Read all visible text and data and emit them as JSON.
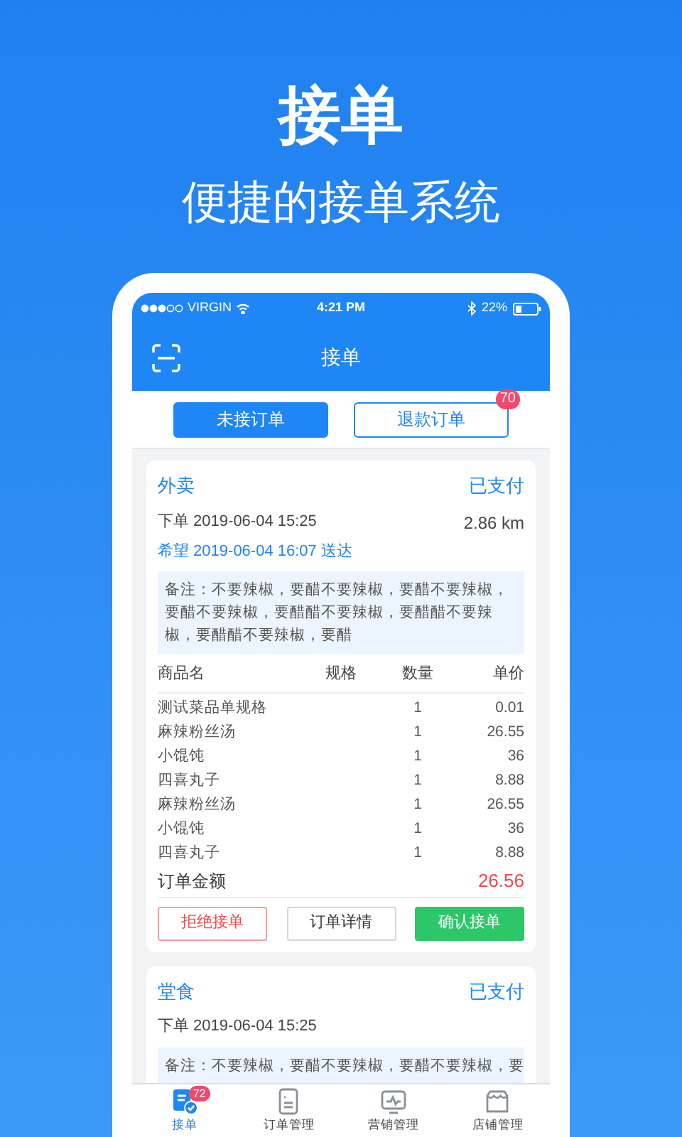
{
  "headline": "接单",
  "subheadline": "便捷的接单系统",
  "status_bar": {
    "carrier": "VIRGIN",
    "time": "4:21 PM",
    "battery": "22%"
  },
  "nav": {
    "title": "接单"
  },
  "tabs": [
    {
      "label": "未接订单",
      "selected": true
    },
    {
      "label": "退款订单",
      "selected": false,
      "badge": "70"
    }
  ],
  "orders": [
    {
      "type": "外卖",
      "status": "已支付",
      "placed": "下单 2019-06-04 15:25",
      "distance": "2.86 km",
      "expected": "希望 2019-06-04 16:07 送达",
      "note": "备注：不要辣椒，要醋不要辣椒，要醋不要辣椒，要醋不要辣椒，要醋醋不要辣椒，要醋醋不要辣椒，要醋醋不要辣椒，要醋",
      "columns": [
        "商品名",
        "规格",
        "数量",
        "单价"
      ],
      "items": [
        {
          "name": "测试菜品单规格",
          "qty": "1",
          "price": "0.01"
        },
        {
          "name": "麻辣粉丝汤",
          "qty": "1",
          "price": "26.55"
        },
        {
          "name": "小馄饨",
          "qty": "1",
          "price": "36"
        },
        {
          "name": "四喜丸子",
          "qty": "1",
          "price": "8.88"
        },
        {
          "name": "麻辣粉丝汤",
          "qty": "1",
          "price": "26.55"
        },
        {
          "name": "小馄饨",
          "qty": "1",
          "price": "36"
        },
        {
          "name": "四喜丸子",
          "qty": "1",
          "price": "8.88"
        }
      ],
      "total_label": "订单金额",
      "total": "26.56",
      "actions": [
        {
          "label": "拒绝接单",
          "kind": "reject"
        },
        {
          "label": "订单详情",
          "kind": "detail"
        },
        {
          "label": "确认接单",
          "kind": "confirm"
        }
      ]
    },
    {
      "type": "堂食",
      "status": "已支付",
      "placed": "下单 2019-06-04 15:25",
      "note": "备注：不要辣椒，要醋不要辣椒，要醋不要辣椒，要"
    }
  ],
  "tab_bar": [
    {
      "label": "接单",
      "selected": true,
      "badge": "72",
      "kind": "orders"
    },
    {
      "label": "订单管理",
      "selected": false,
      "kind": "list"
    },
    {
      "label": "营销管理",
      "selected": false,
      "kind": "chart"
    },
    {
      "label": "店铺管理",
      "selected": false,
      "kind": "shop"
    }
  ]
}
